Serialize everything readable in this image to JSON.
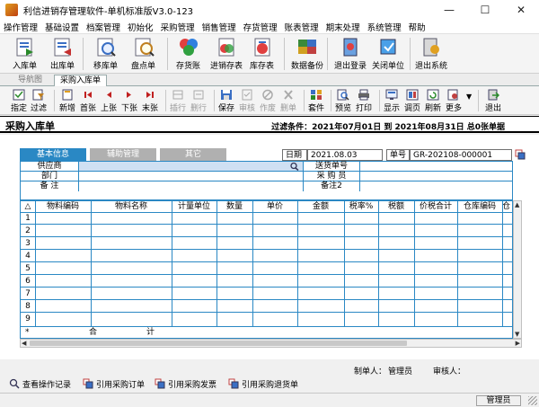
{
  "window": {
    "title": "利信进销存管理软件-单机标准版V3.0-123"
  },
  "menu": [
    "操作管理",
    "基础设置",
    "档案管理",
    "初始化",
    "采购管理",
    "销售管理",
    "存货管理",
    "账表管理",
    "期末处理",
    "系统管理",
    "帮助"
  ],
  "toolbar_main": [
    {
      "label": "入库单",
      "icon": "stock-in-icon"
    },
    {
      "label": "出库单",
      "icon": "stock-out-icon"
    },
    {
      "label": "移库单",
      "icon": "transfer-icon"
    },
    {
      "label": "盘点单",
      "icon": "inventory-count-icon"
    },
    {
      "label": "存货账",
      "icon": "ledger-icon"
    },
    {
      "label": "进销存表",
      "icon": "report-icon"
    },
    {
      "label": "库存表",
      "icon": "stock-table-icon"
    },
    {
      "label": "数据备份",
      "icon": "backup-icon"
    },
    {
      "label": "退出登录",
      "icon": "logout-icon"
    },
    {
      "label": "关闭单位",
      "icon": "close-unit-icon"
    },
    {
      "label": "退出系统",
      "icon": "exit-system-icon"
    }
  ],
  "tabs": {
    "nav": "导航图",
    "active": "采购入库单"
  },
  "toolbar_doc": [
    {
      "label": "指定",
      "icon": "assign-icon"
    },
    {
      "label": "过滤",
      "icon": "filter-icon"
    },
    {
      "label": "新增",
      "icon": "add-icon"
    },
    {
      "label": "首张",
      "icon": "first-icon"
    },
    {
      "label": "上张",
      "icon": "prev-icon"
    },
    {
      "label": "下张",
      "icon": "next-icon"
    },
    {
      "label": "末张",
      "icon": "last-icon"
    },
    {
      "label": "插行",
      "icon": "insert-row-icon"
    },
    {
      "label": "删行",
      "icon": "delete-row-icon"
    },
    {
      "label": "保存",
      "icon": "save-icon"
    },
    {
      "label": "审核",
      "icon": "audit-icon"
    },
    {
      "label": "作废",
      "icon": "void-icon"
    },
    {
      "label": "删单",
      "icon": "delete-doc-icon"
    },
    {
      "label": "套件",
      "icon": "kit-icon"
    },
    {
      "label": "预览",
      "icon": "preview-icon"
    },
    {
      "label": "打印",
      "icon": "print-icon"
    },
    {
      "label": "显示",
      "icon": "display-icon"
    },
    {
      "label": "调页",
      "icon": "adjust-page-icon"
    },
    {
      "label": "刷新",
      "icon": "refresh-icon"
    },
    {
      "label": "更多",
      "icon": "more-icon"
    },
    {
      "label": "退出",
      "icon": "exit-icon"
    }
  ],
  "document": {
    "title": "采购入库单",
    "filter": "过滤条件：2021年07月01日 到 2021年08月31日 总0张单据"
  },
  "subtabs": [
    "基本信息",
    "辅助管理",
    "其它"
  ],
  "header_fields": {
    "date_label": "日期",
    "date_value": "2021.08.03",
    "number_label": "单号",
    "number_value": "GR-202108-000001"
  },
  "form": {
    "supplier_label": "供应商",
    "delivery_no_label": "送货单号",
    "dept_label": "部门",
    "buyer_label": "采 购 员",
    "remark_label": "备  注",
    "remark2_label": "备注2"
  },
  "grid": {
    "columns": [
      "物料编码",
      "物料名称",
      "计量单位",
      "数量",
      "单价",
      "金额",
      "税率%",
      "税额",
      "价税合计",
      "仓库编码",
      "仓"
    ],
    "rows": [
      "1",
      "2",
      "3",
      "4",
      "5",
      "6",
      "7",
      "8",
      "9"
    ],
    "total_marker": "*",
    "total_label_a": "合",
    "total_label_b": "计"
  },
  "footer": {
    "maker_label": "制单人：",
    "maker_value": "管理员",
    "auditor_label": "审核人：",
    "buttons": [
      "查看操作记录",
      "引用采购订单",
      "引用采购发票",
      "引用采购退货单"
    ]
  },
  "status": {
    "user": "管理员"
  }
}
